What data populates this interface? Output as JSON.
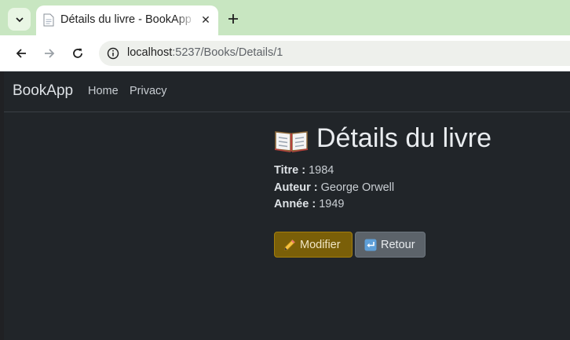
{
  "browser": {
    "tab": {
      "title": "Détails du livre - BookApp"
    },
    "address": {
      "host": "localhost",
      "path": ":5237/Books/Details/1"
    },
    "icons": {
      "tabs_menu": "chevron-down-icon",
      "favicon": "document-icon",
      "close": "close-icon",
      "new_tab": "plus-icon",
      "back": "arrow-left-icon",
      "forward": "arrow-right-icon",
      "reload": "reload-icon",
      "site_info": "info-icon"
    },
    "close_glyph": "✕"
  },
  "navbar": {
    "brand": "BookApp",
    "links": [
      "Home",
      "Privacy"
    ]
  },
  "details": {
    "heading": "Détails du livre",
    "fields": [
      {
        "label": "Titre :",
        "value": "1984"
      },
      {
        "label": "Auteur :",
        "value": "George Orwell"
      },
      {
        "label": "Année :",
        "value": "1949"
      }
    ]
  },
  "actions": {
    "edit_label": "Modifier",
    "back_label": "Retour"
  },
  "colors": {
    "page_bg": "#212529",
    "tabbar_bg": "#c8e6c1",
    "edit_button": "#7a5f08",
    "back_button": "#5c636a"
  }
}
